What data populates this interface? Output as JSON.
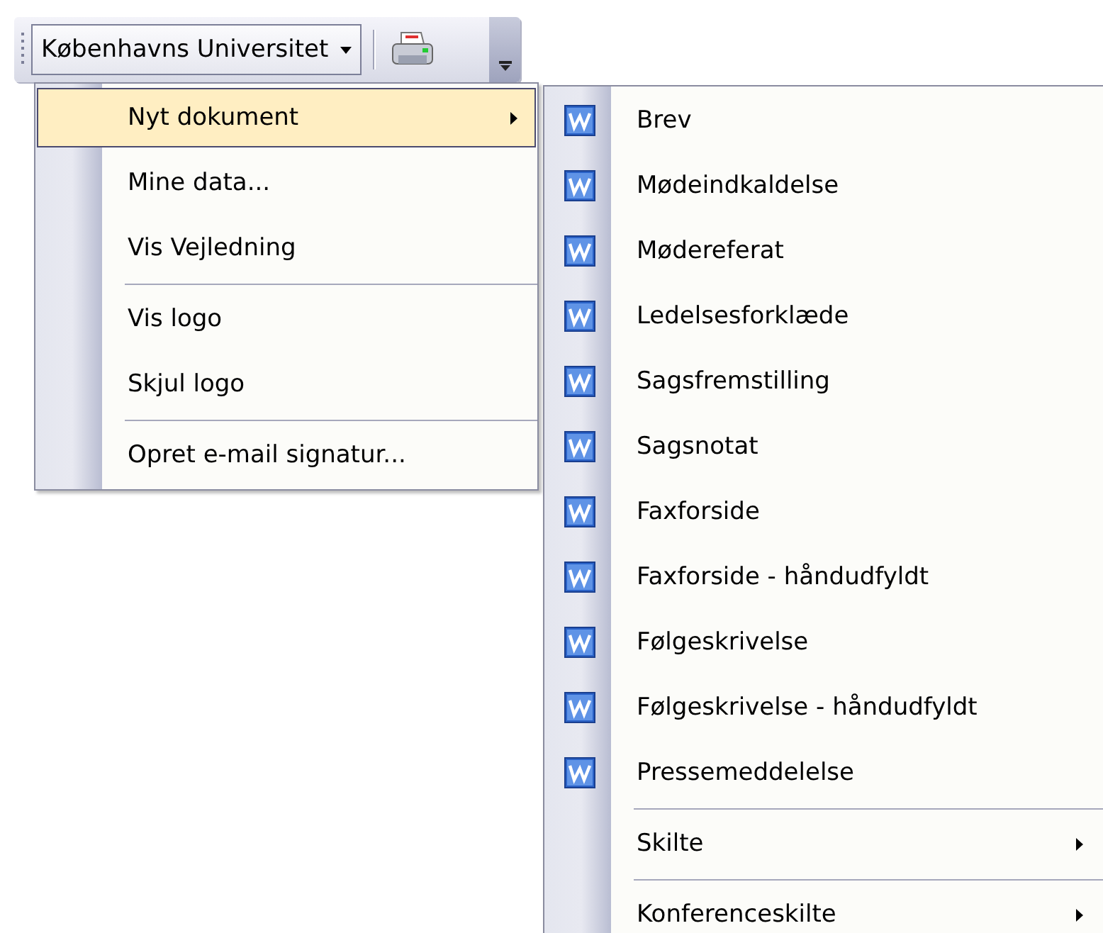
{
  "toolbar": {
    "menu_button": {
      "label": "Københavns Universitet"
    }
  },
  "main_menu": {
    "items": [
      {
        "label": "Nyt dokument",
        "kind": "submenu",
        "separator_before": false,
        "selected": true
      },
      {
        "label": "Mine data...",
        "kind": "command",
        "separator_before": false,
        "selected": false
      },
      {
        "label": "Vis Vejledning",
        "kind": "command",
        "separator_before": false,
        "selected": false
      },
      {
        "label": "Vis logo",
        "kind": "command",
        "separator_before": true,
        "selected": false
      },
      {
        "label": "Skjul logo",
        "kind": "command",
        "separator_before": false,
        "selected": false
      },
      {
        "label": "Opret e-mail signatur...",
        "kind": "command",
        "separator_before": true,
        "selected": false
      }
    ]
  },
  "submenu": {
    "items": [
      {
        "label": "Brev",
        "kind": "template",
        "separator_before": false,
        "selected": false
      },
      {
        "label": "Mødeindkaldelse",
        "kind": "template",
        "separator_before": false,
        "selected": false
      },
      {
        "label": "Mødereferat",
        "kind": "template",
        "separator_before": false,
        "selected": false
      },
      {
        "label": "Ledelsesforklæde",
        "kind": "template",
        "separator_before": false,
        "selected": false
      },
      {
        "label": "Sagsfremstilling",
        "kind": "template",
        "separator_before": false,
        "selected": false
      },
      {
        "label": "Sagsnotat",
        "kind": "template",
        "separator_before": false,
        "selected": false
      },
      {
        "label": "Faxforside",
        "kind": "template",
        "separator_before": false,
        "selected": false
      },
      {
        "label": "Faxforside - håndudfyldt",
        "kind": "template",
        "separator_before": false,
        "selected": false
      },
      {
        "label": "Følgeskrivelse",
        "kind": "template",
        "separator_before": false,
        "selected": false
      },
      {
        "label": "Følgeskrivelse - håndudfyldt",
        "kind": "template",
        "separator_before": false,
        "selected": false
      },
      {
        "label": "Pressemeddelelse",
        "kind": "template",
        "separator_before": false,
        "selected": false
      },
      {
        "label": "Skilte",
        "kind": "submenu",
        "separator_before": true,
        "selected": false
      },
      {
        "label": "Konferenceskilte",
        "kind": "submenu",
        "separator_before": true,
        "selected": false
      }
    ]
  }
}
